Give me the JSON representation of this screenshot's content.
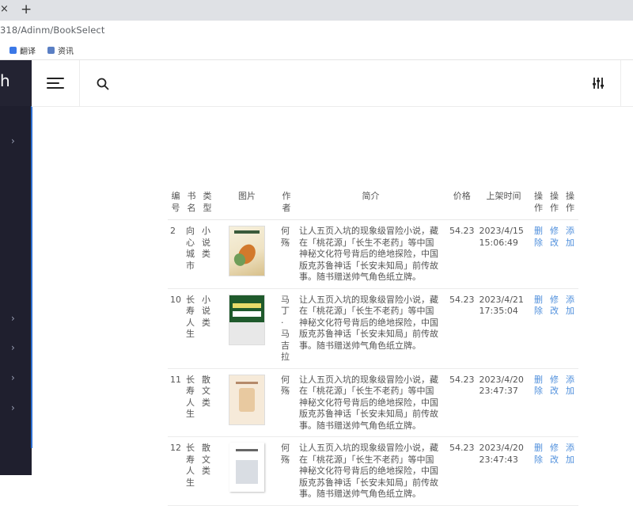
{
  "browser": {
    "close_glyph": "×",
    "new_tab_glyph": "+",
    "url": "318/Adinm/BookSelect",
    "bookmarks": [
      {
        "label": "翻译",
        "icon": "translate-icon",
        "color": "#3b78e7"
      },
      {
        "label": "资讯",
        "icon": "news-icon",
        "color": "#5a7fc4"
      }
    ]
  },
  "sidebar": {
    "logo_text": "h",
    "arrow_glyph": "›"
  },
  "table": {
    "headers": {
      "id": "编号",
      "name": "书名",
      "type": "类型",
      "image": "图片",
      "author": "作者",
      "intro": "简介",
      "price": "价格",
      "time": "上架时间",
      "op1": "操作",
      "op2": "操作",
      "op3": "操作"
    },
    "actions": {
      "delete": "删除",
      "edit": "修改",
      "add": "添加"
    },
    "rows": [
      {
        "id": "2",
        "name": "向心城市",
        "type": "小说类",
        "author": "何殇",
        "intro": "让人五页入坑的现象级冒险小说，藏在「桃花源」「长生不老药」等中国神秘文化符号背后的绝地探险，中国版克苏鲁神话「长安未知局」前传故事。随书赠送帅气角色纸立牌。",
        "price": "54.23",
        "time": "2023/4/15 15:06:49"
      },
      {
        "id": "10",
        "name": "长寿人生",
        "type": "小说类",
        "author": "马丁·马吉拉",
        "intro": "让人五页入坑的现象级冒险小说，藏在「桃花源」「长生不老药」等中国神秘文化符号背后的绝地探险，中国版克苏鲁神话「长安未知局」前传故事。随书赠送帅气角色纸立牌。",
        "price": "54.23",
        "time": "2023/4/21 17:35:04"
      },
      {
        "id": "11",
        "name": "长寿人生",
        "type": "散文类",
        "author": "何殇",
        "intro": "让人五页入坑的现象级冒险小说，藏在「桃花源」「长生不老药」等中国神秘文化符号背后的绝地探险，中国版克苏鲁神话「长安未知局」前传故事。随书赠送帅气角色纸立牌。",
        "price": "54.23",
        "time": "2023/4/20 23:47:37"
      },
      {
        "id": "12",
        "name": "长寿人生",
        "type": "散文类",
        "author": "何殇",
        "intro": "让人五页入坑的现象级冒险小说，藏在「桃花源」「长生不老药」等中国神秘文化符号背后的绝地探险，中国版克苏鲁神话「长安未知局」前传故事。随书赠送帅气角色纸立牌。",
        "price": "54.23",
        "time": "2023/4/20 23:47:43"
      }
    ]
  },
  "colors": {
    "sidebar_bg": "#1f1f2e",
    "link": "#4f8fdc",
    "accent": "#2d6fd0"
  }
}
